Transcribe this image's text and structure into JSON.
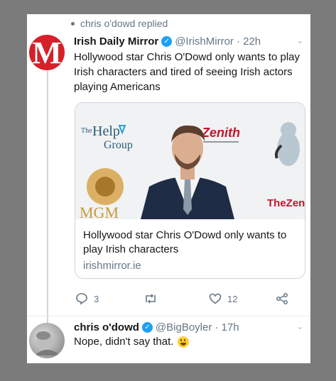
{
  "context": {
    "replied_text": "chris o'dowd replied"
  },
  "tweet": {
    "author_name": "Irish Daily Mirror",
    "handle": "@IrishMirror",
    "time": "· 22h",
    "text": "Hollywood star Chris O'Dowd only wants to play Irish characters and tired of seeing Irish actors playing Americans",
    "avatar_letter": "M",
    "card": {
      "title": "Hollywood star Chris O'Dowd only wants to play Irish characters",
      "domain": "irishmirror.ie",
      "image_texts": {
        "help_the": "The",
        "help_main": "Help",
        "help_group": "Group",
        "zenith": "Zenith",
        "mgm": "MGM",
        "thezen": "TheZen"
      }
    },
    "actions": {
      "replies": "3",
      "retweets": "",
      "likes": "12"
    }
  },
  "reply": {
    "author_name": "chris o'dowd",
    "handle": "@BigBoyler",
    "time": "· 17h",
    "text": "Nope, didn't say that."
  },
  "colors": {
    "accent": "#1da1f2",
    "mirror_red": "#d6202a",
    "muted": "#657786"
  }
}
